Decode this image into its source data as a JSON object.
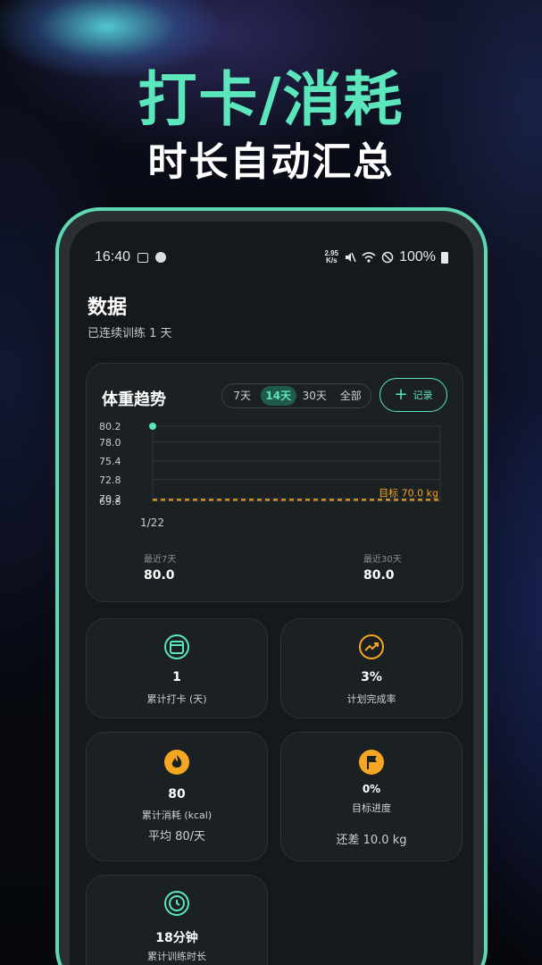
{
  "banner": {
    "headline": "打卡/消耗",
    "subline": "时长自动汇总"
  },
  "status_bar": {
    "time": "16:40",
    "net_speed_value": "2.95",
    "net_speed_unit": "K/s",
    "battery": "100%"
  },
  "page": {
    "title": "数据",
    "subtitle": "已连续训练 1 天"
  },
  "weight_card": {
    "title": "体重趋势",
    "range_tabs": [
      "7天",
      "14天",
      "30天",
      "全部"
    ],
    "active_tab": "14天",
    "record_button": "记录",
    "recent7_label": "最近7天",
    "recent7_value": "80.0",
    "recent30_label": "最近30天",
    "recent30_value": "80.0"
  },
  "chart_data": {
    "type": "line",
    "x": [
      "1/22"
    ],
    "series": [
      {
        "values": [
          80.2
        ]
      }
    ],
    "y_ticks": [
      "80.2",
      "78.0",
      "75.4",
      "72.8",
      "70.2",
      "69.8"
    ],
    "ylim": [
      69.8,
      80.2
    ],
    "target_value": 70.0,
    "target_label": "目标 70.0 kg",
    "grid": true,
    "colors": {
      "line": "#5be6bb",
      "target": "#f5a623",
      "grid": "#2e3438"
    }
  },
  "stats": {
    "checkin": {
      "value": "1",
      "label": "累计打卡 (天)"
    },
    "completion": {
      "value": "3%",
      "label": "计划完成率"
    },
    "calories": {
      "value": "80",
      "label": "累计消耗 (kcal)",
      "extra": "平均 80/天"
    },
    "goal": {
      "value": "0%",
      "label": "目标进度",
      "extra": "还差 10.0 kg"
    },
    "duration": {
      "value": "18分钟",
      "label": "累计训练时长"
    }
  },
  "colors": {
    "accent": "#5be6bb",
    "orange": "#f5a623",
    "card_bg": "#1b2023",
    "screen_bg": "#15191c",
    "frame": "#5fd8b2"
  },
  "icons": [
    "image-icon",
    "app-icon",
    "mute-icon",
    "wifi-icon",
    "dnd-icon",
    "battery-icon",
    "calendar-icon",
    "trend-icon",
    "flame-icon",
    "flag-icon",
    "clock-icon"
  ]
}
